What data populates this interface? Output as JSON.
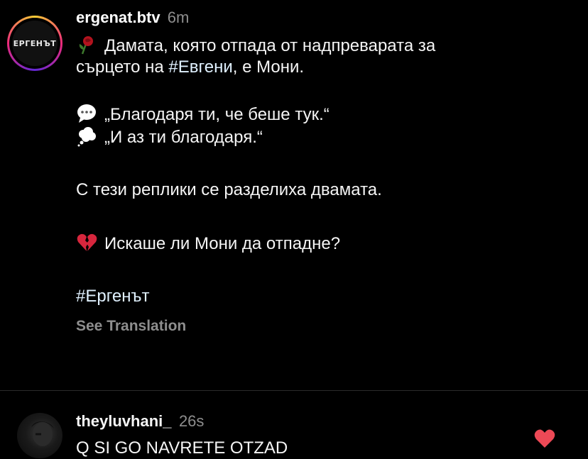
{
  "post": {
    "avatar_logo_text": "ЕРГЕНЪТ",
    "username": "ergenat.btv",
    "time": "6m",
    "lines": {
      "l1": "Дамата, която отпада от надпреварата за",
      "l2_pre": "сърцето на ",
      "l2_hashtag": "#Евгени",
      "l2_post": ", е Мони.",
      "quote1": "„Благодаря ти, че беше тук.“",
      "quote2": "„И аз ти благодаря.“",
      "l5": "С тези реплики се разделиха двамата.",
      "l6": "Искаше ли Мони да отпадне?",
      "hashtag": "#Ергенът"
    },
    "see_translation": "See Translation",
    "icons": [
      "rose-icon",
      "speech-bubble-icon",
      "thought-bubble-icon",
      "broken-heart-icon"
    ]
  },
  "comment": {
    "username": "theyluvhani_",
    "time": "26s",
    "text": "Q SI GO NAVRETE OTZAD",
    "liked": true,
    "heart_color": "#ed4956"
  }
}
